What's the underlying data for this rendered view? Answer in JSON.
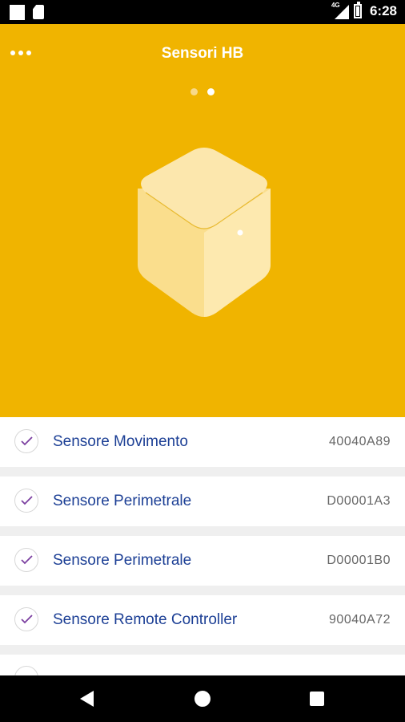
{
  "status_bar": {
    "network": "4G",
    "time": "6:28"
  },
  "header": {
    "title": "Sensori HB",
    "menu_icon": "more-horizontal-icon",
    "pager": {
      "pages": 2,
      "active_index": 1
    }
  },
  "colors": {
    "header_bg": "#f0b400",
    "sensor_name": "#1c3f95",
    "check_mark": "#7b3fa0",
    "code_text": "#666666"
  },
  "sensors": [
    {
      "name": "Sensore Movimento",
      "code": "40040A89",
      "checked": true
    },
    {
      "name": "Sensore Perimetrale",
      "code": "D00001A3",
      "checked": true
    },
    {
      "name": "Sensore Perimetrale",
      "code": "D00001B0",
      "checked": true
    },
    {
      "name": "Sensore Remote Controller",
      "code": "90040A72",
      "checked": true
    }
  ]
}
